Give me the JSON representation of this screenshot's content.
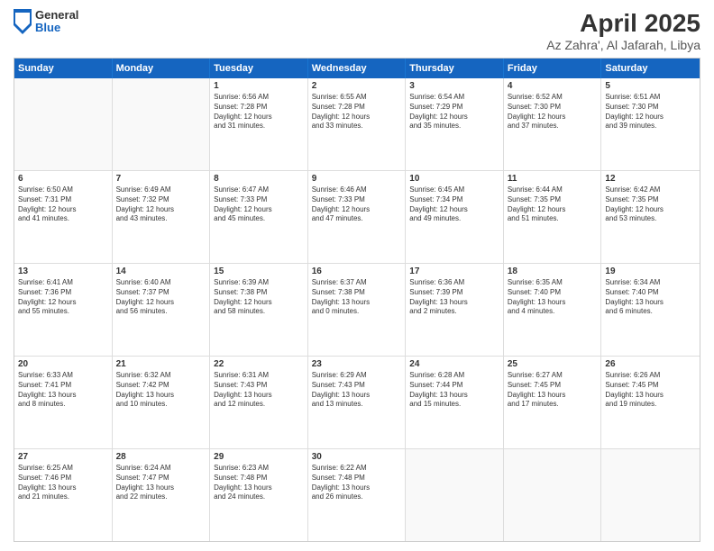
{
  "header": {
    "logo_general": "General",
    "logo_blue": "Blue",
    "title": "April 2025",
    "subtitle": "Az Zahra', Al Jafarah, Libya"
  },
  "days": [
    "Sunday",
    "Monday",
    "Tuesday",
    "Wednesday",
    "Thursday",
    "Friday",
    "Saturday"
  ],
  "rows": [
    [
      {
        "day": "",
        "text": "",
        "empty": true
      },
      {
        "day": "",
        "text": "",
        "empty": true
      },
      {
        "day": "1",
        "text": "Sunrise: 6:56 AM\nSunset: 7:28 PM\nDaylight: 12 hours\nand 31 minutes."
      },
      {
        "day": "2",
        "text": "Sunrise: 6:55 AM\nSunset: 7:28 PM\nDaylight: 12 hours\nand 33 minutes."
      },
      {
        "day": "3",
        "text": "Sunrise: 6:54 AM\nSunset: 7:29 PM\nDaylight: 12 hours\nand 35 minutes."
      },
      {
        "day": "4",
        "text": "Sunrise: 6:52 AM\nSunset: 7:30 PM\nDaylight: 12 hours\nand 37 minutes."
      },
      {
        "day": "5",
        "text": "Sunrise: 6:51 AM\nSunset: 7:30 PM\nDaylight: 12 hours\nand 39 minutes."
      }
    ],
    [
      {
        "day": "6",
        "text": "Sunrise: 6:50 AM\nSunset: 7:31 PM\nDaylight: 12 hours\nand 41 minutes."
      },
      {
        "day": "7",
        "text": "Sunrise: 6:49 AM\nSunset: 7:32 PM\nDaylight: 12 hours\nand 43 minutes."
      },
      {
        "day": "8",
        "text": "Sunrise: 6:47 AM\nSunset: 7:33 PM\nDaylight: 12 hours\nand 45 minutes."
      },
      {
        "day": "9",
        "text": "Sunrise: 6:46 AM\nSunset: 7:33 PM\nDaylight: 12 hours\nand 47 minutes."
      },
      {
        "day": "10",
        "text": "Sunrise: 6:45 AM\nSunset: 7:34 PM\nDaylight: 12 hours\nand 49 minutes."
      },
      {
        "day": "11",
        "text": "Sunrise: 6:44 AM\nSunset: 7:35 PM\nDaylight: 12 hours\nand 51 minutes."
      },
      {
        "day": "12",
        "text": "Sunrise: 6:42 AM\nSunset: 7:35 PM\nDaylight: 12 hours\nand 53 minutes."
      }
    ],
    [
      {
        "day": "13",
        "text": "Sunrise: 6:41 AM\nSunset: 7:36 PM\nDaylight: 12 hours\nand 55 minutes."
      },
      {
        "day": "14",
        "text": "Sunrise: 6:40 AM\nSunset: 7:37 PM\nDaylight: 12 hours\nand 56 minutes."
      },
      {
        "day": "15",
        "text": "Sunrise: 6:39 AM\nSunset: 7:38 PM\nDaylight: 12 hours\nand 58 minutes."
      },
      {
        "day": "16",
        "text": "Sunrise: 6:37 AM\nSunset: 7:38 PM\nDaylight: 13 hours\nand 0 minutes."
      },
      {
        "day": "17",
        "text": "Sunrise: 6:36 AM\nSunset: 7:39 PM\nDaylight: 13 hours\nand 2 minutes."
      },
      {
        "day": "18",
        "text": "Sunrise: 6:35 AM\nSunset: 7:40 PM\nDaylight: 13 hours\nand 4 minutes."
      },
      {
        "day": "19",
        "text": "Sunrise: 6:34 AM\nSunset: 7:40 PM\nDaylight: 13 hours\nand 6 minutes."
      }
    ],
    [
      {
        "day": "20",
        "text": "Sunrise: 6:33 AM\nSunset: 7:41 PM\nDaylight: 13 hours\nand 8 minutes."
      },
      {
        "day": "21",
        "text": "Sunrise: 6:32 AM\nSunset: 7:42 PM\nDaylight: 13 hours\nand 10 minutes."
      },
      {
        "day": "22",
        "text": "Sunrise: 6:31 AM\nSunset: 7:43 PM\nDaylight: 13 hours\nand 12 minutes."
      },
      {
        "day": "23",
        "text": "Sunrise: 6:29 AM\nSunset: 7:43 PM\nDaylight: 13 hours\nand 13 minutes."
      },
      {
        "day": "24",
        "text": "Sunrise: 6:28 AM\nSunset: 7:44 PM\nDaylight: 13 hours\nand 15 minutes."
      },
      {
        "day": "25",
        "text": "Sunrise: 6:27 AM\nSunset: 7:45 PM\nDaylight: 13 hours\nand 17 minutes."
      },
      {
        "day": "26",
        "text": "Sunrise: 6:26 AM\nSunset: 7:45 PM\nDaylight: 13 hours\nand 19 minutes."
      }
    ],
    [
      {
        "day": "27",
        "text": "Sunrise: 6:25 AM\nSunset: 7:46 PM\nDaylight: 13 hours\nand 21 minutes."
      },
      {
        "day": "28",
        "text": "Sunrise: 6:24 AM\nSunset: 7:47 PM\nDaylight: 13 hours\nand 22 minutes."
      },
      {
        "day": "29",
        "text": "Sunrise: 6:23 AM\nSunset: 7:48 PM\nDaylight: 13 hours\nand 24 minutes."
      },
      {
        "day": "30",
        "text": "Sunrise: 6:22 AM\nSunset: 7:48 PM\nDaylight: 13 hours\nand 26 minutes."
      },
      {
        "day": "",
        "text": "",
        "empty": true
      },
      {
        "day": "",
        "text": "",
        "empty": true
      },
      {
        "day": "",
        "text": "",
        "empty": true
      }
    ]
  ]
}
